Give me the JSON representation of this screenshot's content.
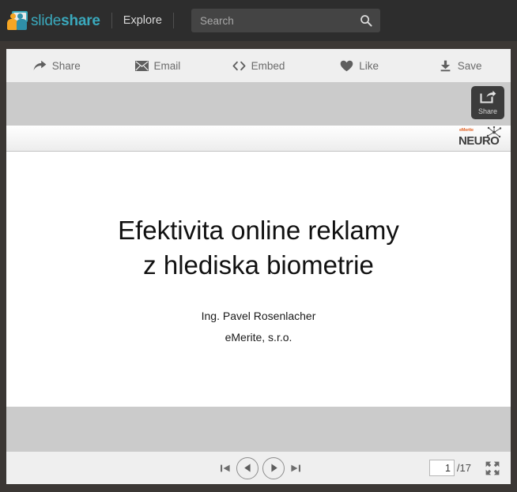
{
  "header": {
    "logo": {
      "name": "slideshare-logo",
      "text_part1": "slide",
      "text_part2": "share"
    },
    "explore_label": "Explore",
    "search": {
      "placeholder": "Search",
      "value": "",
      "icon": "search-icon"
    }
  },
  "actionbar": {
    "items": [
      {
        "label": "Share",
        "icon": "share-arrow-icon"
      },
      {
        "label": "Email",
        "icon": "envelope-icon"
      },
      {
        "label": "Embed",
        "icon": "code-brackets-icon"
      },
      {
        "label": "Like",
        "icon": "heart-icon"
      },
      {
        "label": "Save",
        "icon": "download-icon"
      }
    ]
  },
  "viewer": {
    "share_overlay": {
      "label": "Share",
      "icon": "share-box-arrow-icon"
    },
    "slide": {
      "brand": {
        "small_text": "eMerite",
        "word": "NEURO",
        "icon": "neuron-burst-icon"
      },
      "title_line1": "Efektivita online reklamy",
      "title_line2": "z hlediska biometrie",
      "subtitle_line1": "Ing. Pavel Rosenlacher",
      "subtitle_line2": "eMerite, s.r.o."
    }
  },
  "controls": {
    "first_icon": "skip-to-first-icon",
    "prev_icon": "previous-slide-icon",
    "next_icon": "next-slide-icon",
    "last_icon": "skip-to-last-icon",
    "current_page": "1",
    "total_pages": "/17",
    "fullscreen_icon": "fullscreen-expand-icon"
  },
  "colors": {
    "header_bg": "#2d2d2d",
    "accent_teal": "#3aa9bd",
    "accent_orange": "#f6a623",
    "toolbar_bg": "#efefef",
    "viewer_bg": "#cbcbcb",
    "frame": "#3b3734",
    "slash_orange": "#d98b3e"
  }
}
